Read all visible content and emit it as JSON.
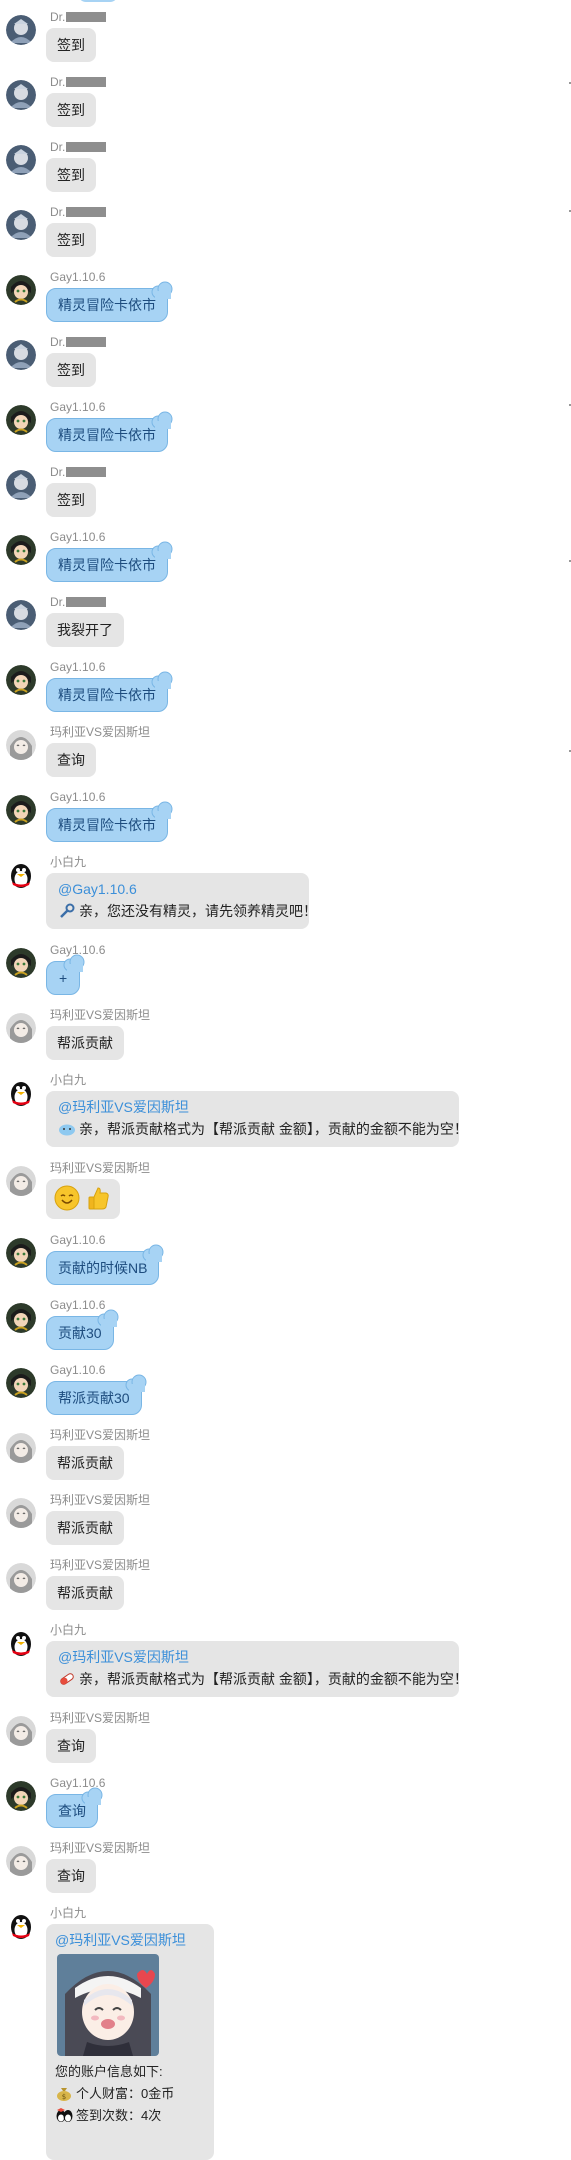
{
  "senders": {
    "dr": "Dr.",
    "gay": "Gay1.10.6",
    "mary": "玛利亚VS爱因斯坦",
    "bai": "小白九"
  },
  "messages": {
    "m1": {
      "text": "签到"
    },
    "m2": {
      "text": "签到"
    },
    "m3": {
      "text": "签到"
    },
    "m4": {
      "text": "签到"
    },
    "m5": {
      "text": "精灵冒险卡依市"
    },
    "m6": {
      "text": "签到"
    },
    "m7": {
      "text": "精灵冒险卡依市"
    },
    "m8": {
      "text": "签到"
    },
    "m9": {
      "text": "精灵冒险卡依市"
    },
    "m10": {
      "text": "我裂开了"
    },
    "m11": {
      "text": "精灵冒险卡依市"
    },
    "m12": {
      "text": "查询"
    },
    "m13": {
      "text": "精灵冒险卡依市"
    },
    "m14": {
      "mention": "@Gay1.10.6",
      "text": "亲，您还没有精灵，请先领养精灵吧！"
    },
    "m15": {
      "text": "+"
    },
    "m16": {
      "text": "帮派贡献"
    },
    "m17": {
      "mention": "@玛利亚VS爱因斯坦",
      "text": "亲，帮派贡献格式为【帮派贡献 金额】，贡献的金额不能为空！"
    },
    "m18": {
      "emoji": [
        "smile-emoji-icon",
        "thumbs-up-emoji-icon"
      ]
    },
    "m19": {
      "text": "贡献的时候NB"
    },
    "m20": {
      "text": "贡献30"
    },
    "m21": {
      "text": "帮派贡献30"
    },
    "m22": {
      "text": "帮派贡献"
    },
    "m23": {
      "text": "帮派贡献"
    },
    "m24": {
      "text": "帮派贡献"
    },
    "m25": {
      "mention": "@玛利亚VS爱因斯坦",
      "text": "亲，帮派贡献格式为【帮派贡献 金额】，贡献的金额不能为空！"
    },
    "m26": {
      "text": "查询"
    },
    "m27": {
      "text": "查询"
    },
    "m28": {
      "text": "查询"
    },
    "m29": {
      "mention": "@玛利亚VS爱因斯坦",
      "intro": "您的账户信息如下:",
      "wealth": "个人财富：0金币",
      "checkins": "签到次数：4次"
    }
  },
  "colors": {
    "bubble_gray": "#e5e5e5",
    "bubble_blue": "#a7d3f4",
    "mention": "#3b8fd9",
    "name": "#8c8c8c"
  }
}
